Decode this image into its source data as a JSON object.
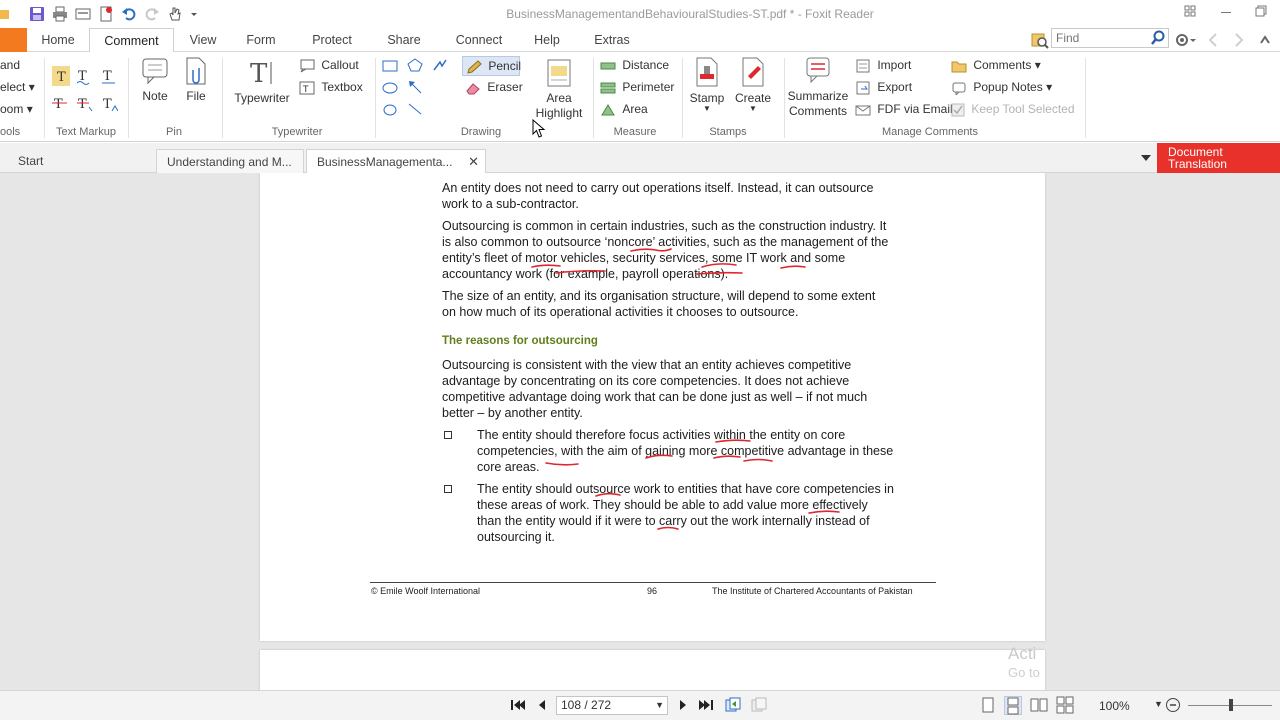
{
  "titlebar": {
    "title": "BusinessManagementandBehaviouralStudies-ST.pdf * - Foxit Reader"
  },
  "ribbon_tabs": [
    {
      "label": "Home"
    },
    {
      "label": "Comment"
    },
    {
      "label": "View"
    },
    {
      "label": "Form"
    },
    {
      "label": "Protect"
    },
    {
      "label": "Share"
    },
    {
      "label": "Connect"
    },
    {
      "label": "Help"
    },
    {
      "label": "Extras"
    }
  ],
  "search": {
    "placeholder": "Find"
  },
  "ribbon": {
    "tools_group": {
      "hand": "and",
      "select": "elect",
      "zoom": "oom",
      "label": "ools"
    },
    "text_markup_label": "Text Markup",
    "pin": {
      "note": "Note",
      "file": "File",
      "label": "Pin"
    },
    "typewriter": {
      "typewriter": "Typewriter",
      "callout": "Callout",
      "textbox": "Textbox",
      "label": "Typewriter"
    },
    "drawing": {
      "pencil": "Pencil",
      "eraser": "Eraser",
      "label": "Drawing"
    },
    "area_highlight": {
      "line1": "Area",
      "line2": "Highlight"
    },
    "measure": {
      "distance": "Distance",
      "perimeter": "Perimeter",
      "area": "Area",
      "label": "Measure"
    },
    "stamps": {
      "stamp": "Stamp",
      "create": "Create",
      "label": "Stamps"
    },
    "manage": {
      "summarize1": "Summarize",
      "summarize2": "Comments",
      "import": "Import",
      "export": "Export",
      "fdf": "FDF via Email",
      "comments": "Comments",
      "popup": "Popup Notes",
      "keep": "Keep Tool Selected",
      "label": "Manage Comments"
    }
  },
  "doc_tabs": [
    {
      "label": "Start"
    },
    {
      "label": "Understanding and M..."
    },
    {
      "label": "BusinessManagementa..."
    }
  ],
  "doc_translation": {
    "line1": "Document",
    "line2": "Translation"
  },
  "page": {
    "p1": [
      "An entity does not need to carry out operations itself. Instead, it can outsource",
      "work to a sub-contractor."
    ],
    "p2": [
      "Outsourcing is common in certain industries, such as the construction industry. It",
      "is also common to outsource ‘noncore’ activities, such as the management of the",
      "entity’s fleet of motor vehicles, security services, some IT work and some",
      "accountancy work (for example, payroll operations)."
    ],
    "p3": [
      "The size of an entity, and its organisation structure, will depend to some extent",
      "on how much of its operational activities it chooses to outsource."
    ],
    "heading": "The reasons for outsourcing",
    "p4": [
      "Outsourcing is consistent with the view that an entity achieves competitive",
      "advantage by concentrating on its core competencies. It does not achieve",
      "competitive advantage doing work that can be done just as well – if not much",
      "better – by another entity."
    ],
    "b1": [
      "The entity should therefore focus activities within the entity on core",
      "competencies, with the aim of gaining more competitive advantage in these",
      "core areas."
    ],
    "b2": [
      "The entity should outsource work to entities that have core competencies in",
      "these areas of work. They should be able to add value more effectively",
      "than the entity would if it were to carry out the work internally instead of",
      "outsourcing it."
    ],
    "footer_left": "© Emile Woolf International",
    "footer_page": "96",
    "footer_right": "The Institute of Chartered Accountants of Pakistan"
  },
  "watermark": {
    "line1": "Acti",
    "line2": "Go to"
  },
  "statusbar": {
    "page_field": "108 / 272",
    "zoom": "100%"
  },
  "colors": {
    "accent_orange": "#f47a20",
    "translation_red": "#e8312a",
    "ink_red": "#e0262e",
    "heading_green": "#5f7f1a"
  }
}
